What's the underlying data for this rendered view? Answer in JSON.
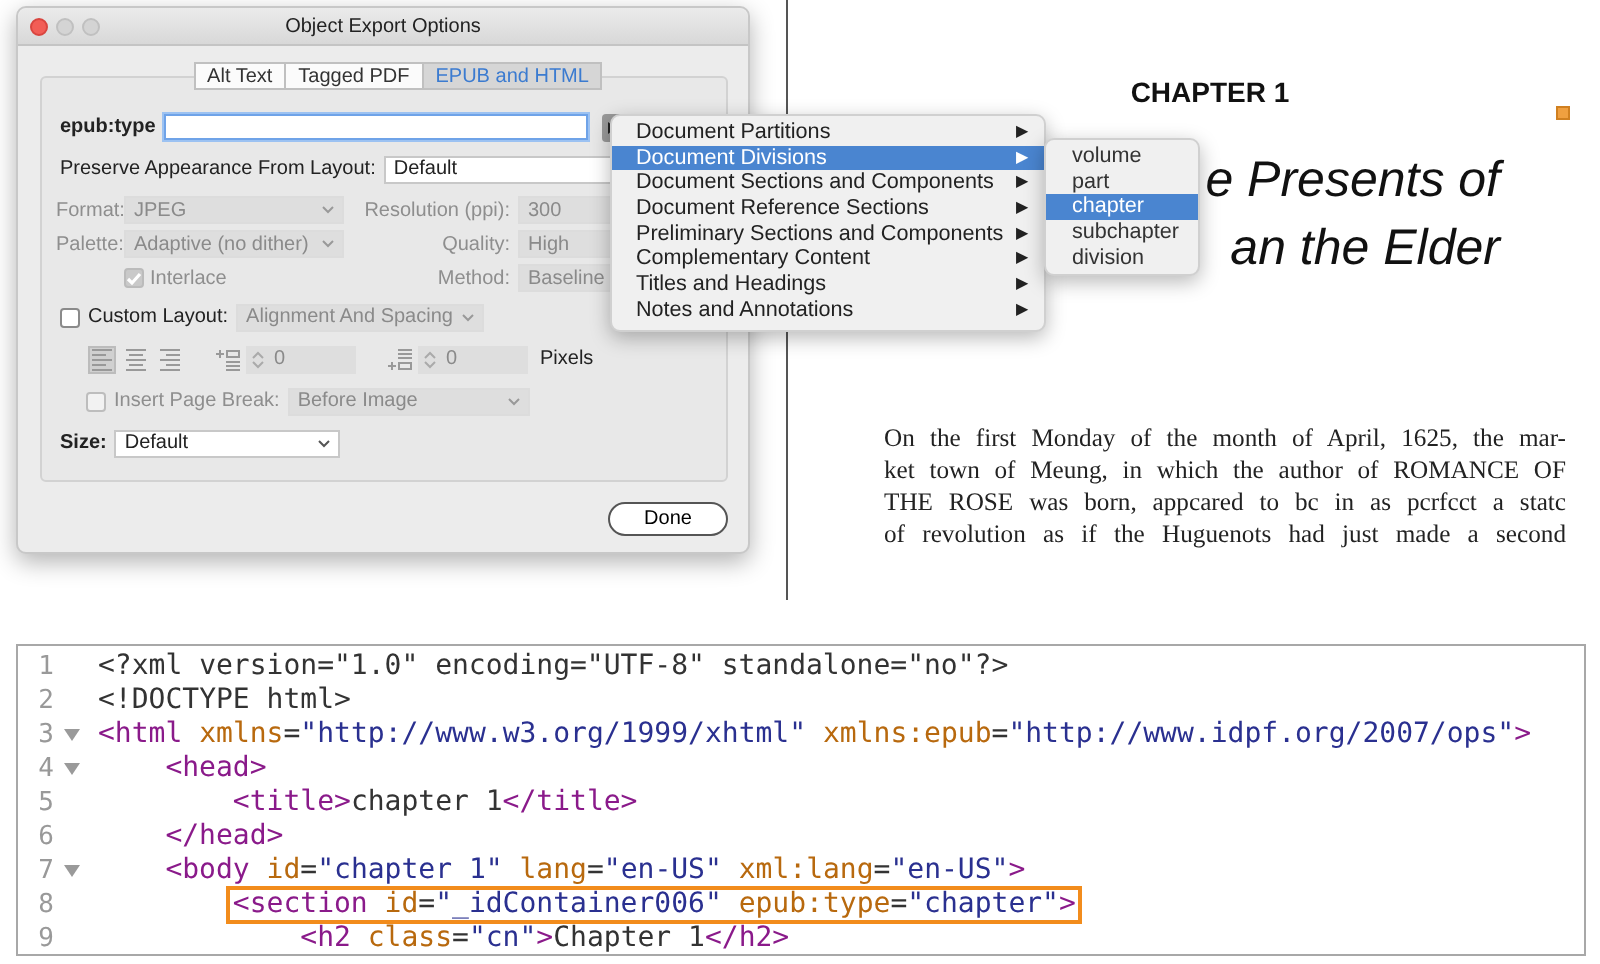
{
  "dialog": {
    "title": "Object Export Options",
    "tabs": [
      {
        "label": "Alt Text",
        "selected": false
      },
      {
        "label": "Tagged PDF",
        "selected": false
      },
      {
        "label": "EPUB and HTML",
        "selected": true
      }
    ],
    "epub_type": {
      "label": "epub:type"
    },
    "preserve": {
      "label": "Preserve Appearance From Layout:",
      "value": "Default"
    },
    "image_rows": [
      {
        "left": {
          "kind": "select",
          "label": "Format:",
          "value": "JPEG",
          "disabled": true
        },
        "right": {
          "label": "Resolution (ppi):",
          "value": "300",
          "disabled": true
        }
      },
      {
        "left": {
          "kind": "select",
          "label": "Palette:",
          "value": "Adaptive (no dither)",
          "disabled": true
        },
        "right": {
          "label": "Quality:",
          "value": "High",
          "disabled": true
        }
      },
      {
        "left": {
          "kind": "checkbox",
          "label": "Interlace",
          "checked": true,
          "disabled": true
        },
        "right": {
          "label": "Method:",
          "value": "Baseline",
          "disabled": true
        }
      }
    ],
    "custom_layout": {
      "label": "Custom Layout:",
      "checked": false,
      "disabled": false,
      "value": "Alignment And Spacing",
      "value_disabled": true
    },
    "alignment_buttons": [
      {
        "kind": "left",
        "selected": true
      },
      {
        "kind": "center",
        "selected": false
      },
      {
        "kind": "right",
        "selected": false
      }
    ],
    "spacing_fields": [
      {
        "kind": "before",
        "value": "0",
        "disabled": true
      },
      {
        "kind": "after",
        "value": "0",
        "disabled": true
      }
    ],
    "units": "Pixels",
    "page_break": {
      "label": "Insert Page Break:",
      "checked": false,
      "disabled": true,
      "value": "Before Image",
      "value_disabled": true
    },
    "size": {
      "label": "Size:",
      "value": "Default"
    },
    "done_button": "Done"
  },
  "type_menu": {
    "items": [
      {
        "label": "Document Partitions",
        "arrow": "▶",
        "selected": false
      },
      {
        "label": "Document Divisions",
        "arrow": "▶",
        "selected": true
      },
      {
        "label": "Document Sections and Components",
        "arrow": "▶",
        "selected": false
      },
      {
        "label": "Document Reference Sections",
        "arrow": "▶",
        "selected": false
      },
      {
        "label": "Preliminary Sections and Components",
        "arrow": "▶",
        "selected": false
      },
      {
        "label": "Complementary Content",
        "arrow": "▶",
        "selected": false
      },
      {
        "label": "Titles and Headings",
        "arrow": "▶",
        "selected": false
      },
      {
        "label": "Notes and Annotations",
        "arrow": "▶",
        "selected": false
      }
    ]
  },
  "submenu": {
    "items": [
      {
        "label": "volume",
        "selected": false
      },
      {
        "label": "part",
        "selected": false
      },
      {
        "label": "chapter",
        "selected": true
      },
      {
        "label": "subchapter",
        "selected": false
      },
      {
        "label": "division",
        "selected": false
      }
    ]
  },
  "page": {
    "heading": "CHAPTER 1",
    "title_lines": [
      "e Presents of",
      "an the Elder"
    ],
    "paragraph_lines": [
      "On the first Monday of the month of April, 1625, the mar-",
      "ket town of Meung, in which the author of ROMANCE OF",
      "THE ROSE was born, appcared to bc in as pcrfcct a statc",
      "of revolution as if the Huguenots had just made a second"
    ]
  },
  "code": {
    "lines": [
      {
        "number": "1",
        "foldable": false,
        "highlighted": false,
        "tokens": [
          {
            "kind": "plain",
            "text": "<?xml version=\"1.0\" encoding=\"UTF-8\" standalone=\"no\"?>"
          }
        ]
      },
      {
        "number": "2",
        "foldable": false,
        "highlighted": false,
        "tokens": [
          {
            "kind": "plain",
            "text": "<!DOCTYPE html>"
          }
        ]
      },
      {
        "number": "3",
        "foldable": true,
        "highlighted": false,
        "tokens": [
          {
            "kind": "tag",
            "text": "<html"
          },
          {
            "kind": "attr",
            "text": " xmlns"
          },
          {
            "kind": "plain",
            "text": "="
          },
          {
            "kind": "value",
            "text": "\"http://www.w3.org/1999/xhtml\""
          },
          {
            "kind": "attr",
            "text": " xmlns:epub"
          },
          {
            "kind": "plain",
            "text": "="
          },
          {
            "kind": "value",
            "text": "\"http://www.idpf.org/2007/ops\""
          },
          {
            "kind": "tag",
            "text": ">"
          }
        ],
        "children": [
          {
            "number": "4",
            "foldable": true,
            "highlighted": false,
            "tokens": [
              {
                "kind": "tag",
                "text": "<head>"
              }
            ],
            "children": [
              {
                "number": "5",
                "foldable": false,
                "highlighted": false,
                "tokens": [
                  {
                    "kind": "tag",
                    "text": "<title>"
                  },
                  {
                    "kind": "plain",
                    "text": "chapter 1"
                  },
                  {
                    "kind": "tag",
                    "text": "</title>"
                  }
                ]
              }
            ]
          },
          {
            "number": "6",
            "foldable": false,
            "highlighted": false,
            "tokens": [
              {
                "kind": "tag",
                "text": "</head>"
              }
            ]
          },
          {
            "number": "7",
            "foldable": true,
            "highlighted": false,
            "tokens": [
              {
                "kind": "tag",
                "text": "<body"
              },
              {
                "kind": "attr",
                "text": " id"
              },
              {
                "kind": "plain",
                "text": "="
              },
              {
                "kind": "value",
                "text": "\"chapter 1\""
              },
              {
                "kind": "attr",
                "text": " lang"
              },
              {
                "kind": "plain",
                "text": "="
              },
              {
                "kind": "value",
                "text": "\"en-US\""
              },
              {
                "kind": "attr",
                "text": " xml:lang"
              },
              {
                "kind": "plain",
                "text": "="
              },
              {
                "kind": "value",
                "text": "\"en-US\""
              },
              {
                "kind": "tag",
                "text": ">"
              }
            ],
            "children": [
              {
                "number": "8",
                "foldable": false,
                "highlighted": true,
                "tokens": [
                  {
                    "kind": "tag",
                    "text": "<section"
                  },
                  {
                    "kind": "attr",
                    "text": " id"
                  },
                  {
                    "kind": "plain",
                    "text": "="
                  },
                  {
                    "kind": "value",
                    "text": "\"_idContainer006\""
                  },
                  {
                    "kind": "attr",
                    "text": " epub:type"
                  },
                  {
                    "kind": "plain",
                    "text": "="
                  },
                  {
                    "kind": "value",
                    "text": "\"chapter\""
                  },
                  {
                    "kind": "tag",
                    "text": ">"
                  }
                ],
                "children": [
                  {
                    "number": "9",
                    "foldable": false,
                    "highlighted": false,
                    "tokens": [
                      {
                        "kind": "tag",
                        "text": "<h2"
                      },
                      {
                        "kind": "attr",
                        "text": " class"
                      },
                      {
                        "kind": "plain",
                        "text": "="
                      },
                      {
                        "kind": "value",
                        "text": "\"cn\""
                      },
                      {
                        "kind": "tag",
                        "text": ">"
                      },
                      {
                        "kind": "plain",
                        "text": "Chapter 1"
                      },
                      {
                        "kind": "tag",
                        "text": "</h2>"
                      }
                    ]
                  }
                ]
              }
            ]
          }
        ]
      }
    ]
  }
}
